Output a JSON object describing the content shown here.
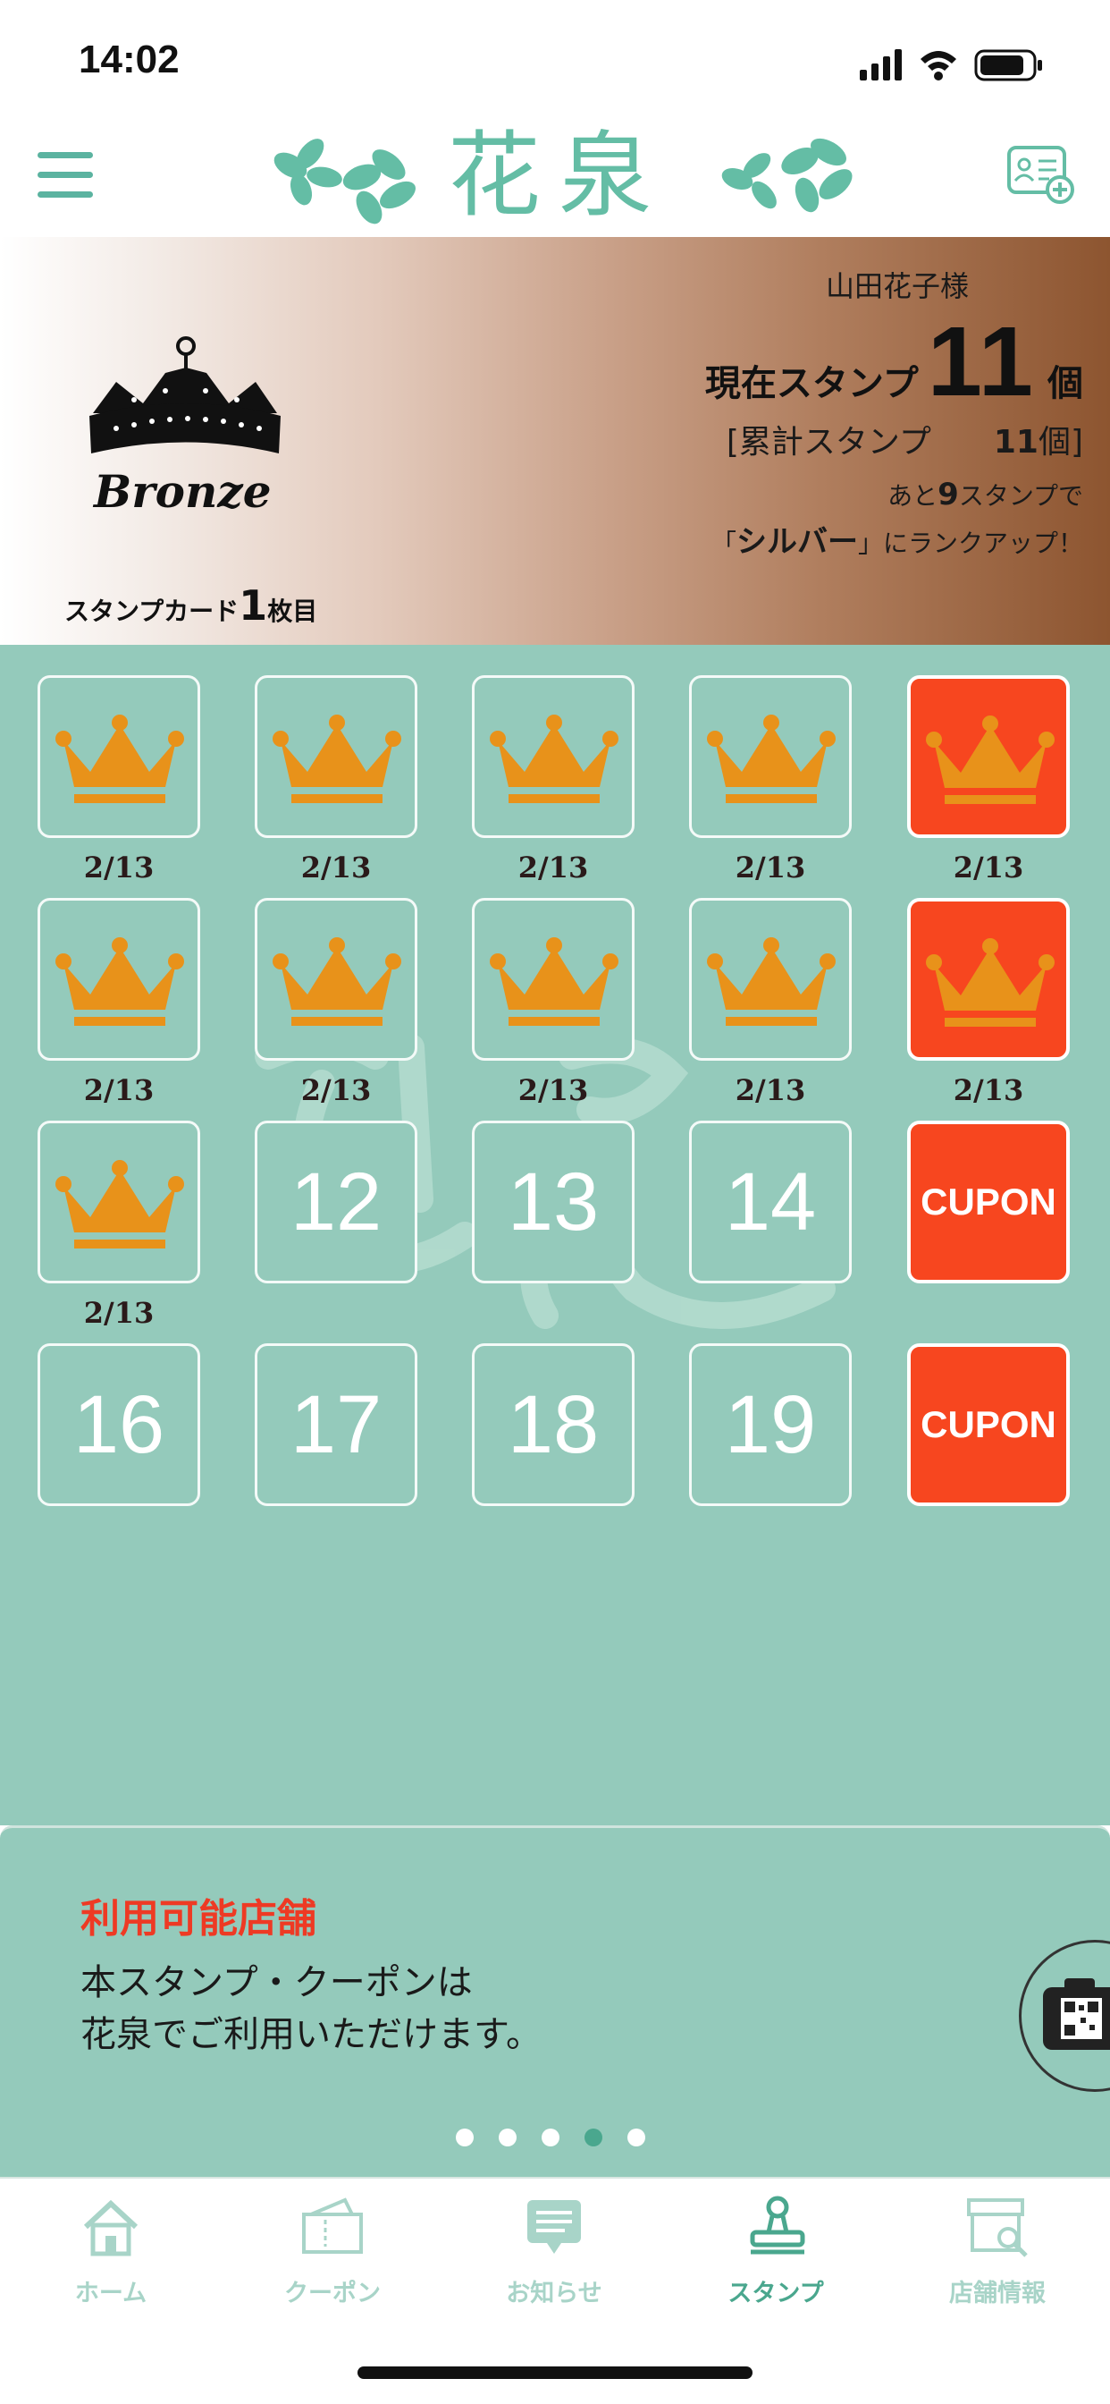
{
  "status_bar": {
    "time": "14:02"
  },
  "header": {
    "logo_text": "花泉"
  },
  "member": {
    "rank_name": "Bronze",
    "name": "山田花子様",
    "current_label": "現在スタンプ",
    "current_count": "11",
    "current_unit": "個",
    "total_open": "[累計スタンプ",
    "total_count": "11",
    "total_close": "個]",
    "remaining_pre": "あと",
    "remaining_count": "9",
    "remaining_post": "スタンプで",
    "next_rank_open": "「",
    "next_rank": "シルバー",
    "next_rank_close": "」にランクアップ！",
    "card_pre": "スタンプカード",
    "card_number": "1",
    "card_post": "枚目"
  },
  "stamps": [
    {
      "state": "stamped",
      "date": "2/13",
      "reward": false
    },
    {
      "state": "stamped",
      "date": "2/13",
      "reward": false
    },
    {
      "state": "stamped",
      "date": "2/13",
      "reward": false
    },
    {
      "state": "stamped",
      "date": "2/13",
      "reward": false
    },
    {
      "state": "stamped",
      "date": "2/13",
      "reward": true
    },
    {
      "state": "stamped",
      "date": "2/13",
      "reward": false
    },
    {
      "state": "stamped",
      "date": "2/13",
      "reward": false
    },
    {
      "state": "stamped",
      "date": "2/13",
      "reward": false
    },
    {
      "state": "stamped",
      "date": "2/13",
      "reward": false
    },
    {
      "state": "stamped",
      "date": "2/13",
      "reward": true
    },
    {
      "state": "stamped",
      "date": "2/13",
      "reward": false
    },
    {
      "state": "empty",
      "number": "12"
    },
    {
      "state": "empty",
      "number": "13"
    },
    {
      "state": "empty",
      "number": "14"
    },
    {
      "state": "coupon",
      "label": "CUPON"
    },
    {
      "state": "empty",
      "number": "16"
    },
    {
      "state": "empty",
      "number": "17"
    },
    {
      "state": "empty",
      "number": "18"
    },
    {
      "state": "empty",
      "number": "19"
    },
    {
      "state": "coupon",
      "label": "CUPON"
    }
  ],
  "info": {
    "title": "利用可能店舗",
    "body_line1": "本スタンプ・クーポンは",
    "body_line2": "花泉でご利用いただけます。",
    "page_count": 5,
    "active_page": 4
  },
  "tabs": [
    {
      "label": "ホーム",
      "icon": "home-icon",
      "active": false
    },
    {
      "label": "クーポン",
      "icon": "coupon-icon",
      "active": false
    },
    {
      "label": "お知らせ",
      "icon": "news-icon",
      "active": false
    },
    {
      "label": "スタンプ",
      "icon": "stamp-icon",
      "active": true
    },
    {
      "label": "店舗情報",
      "icon": "shop-icon",
      "active": false
    }
  ],
  "colors": {
    "brand_green": "#64bda5",
    "stamp_bg": "#94cabb",
    "reward_red": "#f7461f",
    "crown_orange": "#e8921a",
    "tab_active": "#4aa78e",
    "tab_inactive": "#a8d4c8"
  }
}
